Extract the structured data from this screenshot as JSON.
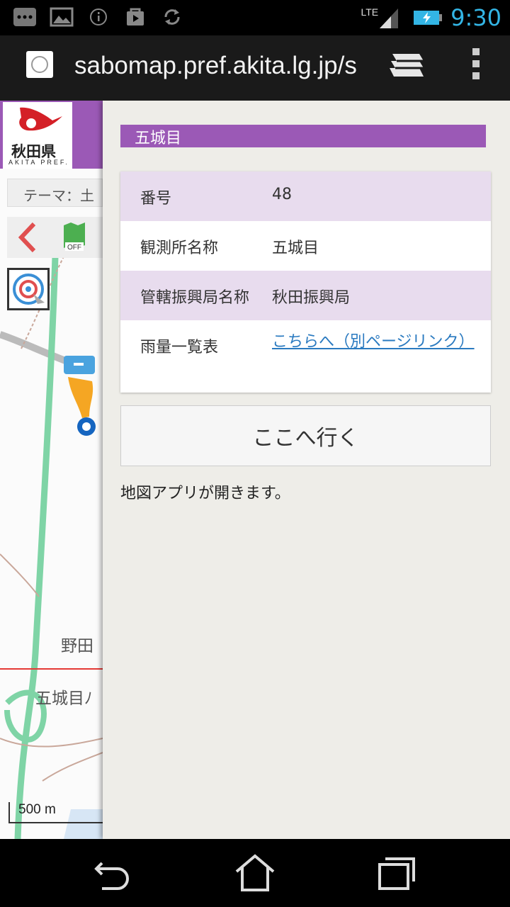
{
  "status_bar": {
    "time": "9:30",
    "network": "LTE",
    "icons": [
      "bbm-icon",
      "image-icon",
      "info-icon",
      "shopping-bag-icon",
      "sync-icon",
      "signal-icon",
      "battery-charging-icon"
    ]
  },
  "browser": {
    "url": "sabomap.pref.akita.lg.jp/s",
    "icons": [
      "favicon-globe-icon",
      "tabs-stack-icon",
      "overflow-menu-icon"
    ]
  },
  "map": {
    "logo_name": "秋田県",
    "logo_en": "AKITA PREF.",
    "theme_label": "テーマ：土",
    "map_labels": [
      "野田",
      "五城目ﾉ"
    ],
    "scale_label": "500 m",
    "accent_color": "#9b59b6"
  },
  "panel": {
    "title": "五城目",
    "rows": [
      {
        "key": "番号",
        "value": "48"
      },
      {
        "key": "観測所名称",
        "value": "五城目"
      },
      {
        "key": "管轄振興局名称",
        "value": "秋田振興局"
      },
      {
        "key": "雨量一覧表",
        "value": "こちらへ（別ページリンク）"
      }
    ],
    "goto_button": "ここへ行く",
    "note": "地図アプリが開きます。",
    "link_color": "#2a7ac0"
  },
  "nav": {
    "icons": [
      "back-icon",
      "home-icon",
      "recent-apps-icon"
    ]
  }
}
